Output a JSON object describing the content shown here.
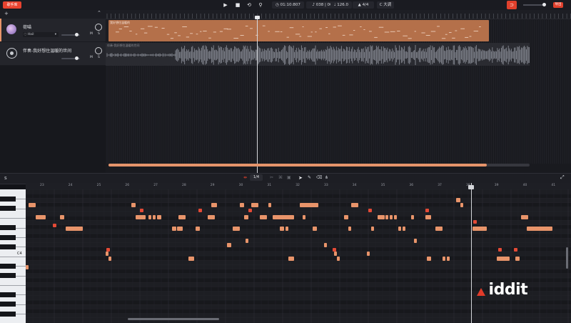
{
  "topbar": {
    "logo_label": "歌手库",
    "play_icon": "play-icon",
    "stop_icon": "stop-icon",
    "loop_icon": "loop-icon",
    "metronome_icon": "metronome-icon",
    "time": "01:10:807",
    "position": "038 | 00",
    "tempo": "126.0",
    "time_signature": "4/4",
    "key": "C 大调",
    "export_label": "导出",
    "accent_color": "#e0402c"
  },
  "tracks": [
    {
      "name": "荷喵",
      "mode": "Hail",
      "type": "vocal",
      "mute": "M",
      "solo": "S"
    },
    {
      "name": "伴奏-我好想住温暖的世间",
      "type": "audio",
      "mute": "M",
      "solo": "S"
    }
  ],
  "clips": {
    "vocal_label": "我好想住温暖的",
    "accompaniment_label": "伴奏-我好想住温暖的世间"
  },
  "editor": {
    "snap": "1/4",
    "c4_label": "C4",
    "bar_numbers": [
      "23",
      "24",
      "25",
      "26",
      "27",
      "28",
      "29",
      "30",
      "31",
      "32",
      "33",
      "34",
      "35",
      "36",
      "37",
      "38",
      "39",
      "40",
      "41"
    ],
    "note_labels": [
      "C4"
    ]
  },
  "brand": "Aiddit"
}
